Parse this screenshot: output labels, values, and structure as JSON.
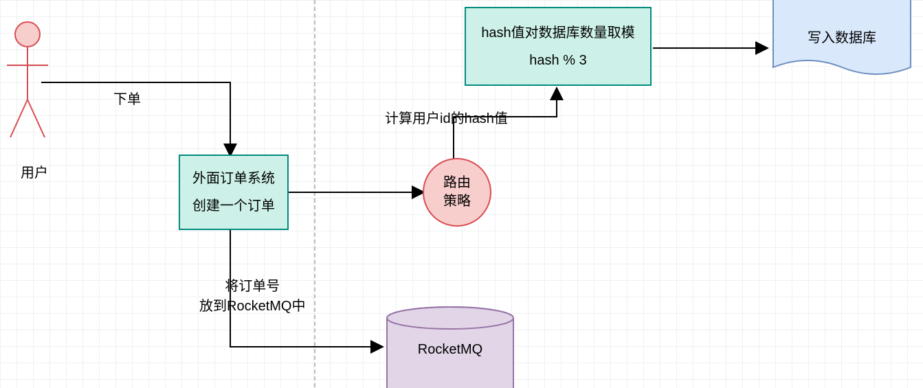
{
  "actor": {
    "label": "用户"
  },
  "orderSystem": {
    "line1": "外面订单系统",
    "line2": "创建一个订单"
  },
  "routing": {
    "line1": "路由",
    "line2": "策略"
  },
  "hashBox": {
    "line1": "hash值对数据库数量取模",
    "line2": "hash % 3"
  },
  "rocketmq": {
    "label": "RocketMQ"
  },
  "database": {
    "label": "写入数据库"
  },
  "labels": {
    "placeOrder": "下单",
    "hashUserId": "计算用户id的hash值",
    "putOrderMQ1": "将订单号",
    "putOrderMQ2": "放到RocketMQ中"
  }
}
